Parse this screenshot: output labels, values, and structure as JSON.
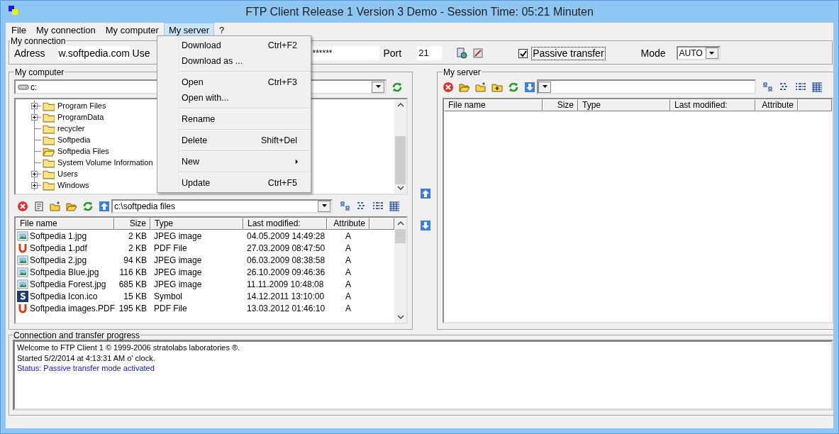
{
  "window": {
    "title": "FTP Client Release 1 Version 3 Demo - Session Time: 05:21 Minuten"
  },
  "menu_bar": [
    {
      "label": "File",
      "selected": false
    },
    {
      "label": "My connection",
      "selected": false
    },
    {
      "label": "My computer",
      "selected": false
    },
    {
      "label": "My server",
      "selected": true
    },
    {
      "label": "?",
      "selected": false
    }
  ],
  "dropdown_menu": {
    "items": [
      {
        "kind": "item",
        "label": "Download",
        "shortcut": "Ctrl+F2"
      },
      {
        "kind": "item",
        "label": "Download as ..."
      },
      {
        "kind": "separator"
      },
      {
        "kind": "item",
        "label": "Open",
        "shortcut": "Ctrl+F3"
      },
      {
        "kind": "item",
        "label": "Open with..."
      },
      {
        "kind": "separator"
      },
      {
        "kind": "item",
        "label": "Rename"
      },
      {
        "kind": "separator"
      },
      {
        "kind": "item",
        "label": "Delete",
        "shortcut": "Shift+Del"
      },
      {
        "kind": "separator"
      },
      {
        "kind": "submenu",
        "label": "New"
      },
      {
        "kind": "separator"
      },
      {
        "kind": "item",
        "label": "Update",
        "shortcut": "Ctrl+F5"
      }
    ]
  },
  "connection": {
    "group_label": "My connection",
    "address_label": "Adress",
    "address_value": "w.softpedia.com",
    "user_label": "Use",
    "password_value": "******",
    "port_label": "Port",
    "port_value": "21",
    "passive_transfer": {
      "label": "Passive transfer",
      "checked": true
    },
    "mode_label": "Mode",
    "mode_value": "AUTO"
  },
  "my_computer": {
    "title": "My computer",
    "drive": "c:",
    "tree": [
      {
        "label": "Program Files",
        "has_children": true,
        "open": false
      },
      {
        "label": "ProgramData",
        "has_children": true,
        "open": false
      },
      {
        "label": "recycler",
        "has_children": false,
        "open": false
      },
      {
        "label": "Softpedia",
        "has_children": false,
        "open": false
      },
      {
        "label": "Softpedia Files",
        "has_children": false,
        "open": true
      },
      {
        "label": "System Volume Information",
        "has_children": false,
        "open": false
      },
      {
        "label": "Users",
        "has_children": true,
        "open": false
      },
      {
        "label": "Windows",
        "has_children": true,
        "open": false
      }
    ],
    "path": "c:\\softpedia files",
    "columns": [
      "File name",
      "Size",
      "Type",
      "Last modified:",
      "Attribute"
    ],
    "rows": [
      {
        "kind": "image",
        "cells": [
          "Softpedia 1.jpg",
          "2 KB",
          "JPEG image",
          "04.05.2009 14:49:28",
          "A"
        ]
      },
      {
        "kind": "pdf",
        "cells": [
          "Softpedia 1.pdf",
          "2 KB",
          "PDF File",
          "27.03.2009 08:47:50",
          "A"
        ]
      },
      {
        "kind": "image",
        "cells": [
          "Softpedia 2.jpg",
          "94 KB",
          "JPEG image",
          "06.03.2009 08:38:58",
          "A"
        ]
      },
      {
        "kind": "image",
        "cells": [
          "Softpedia Blue.jpg",
          "116 KB",
          "JPEG image",
          "26.10.2009 09:46:36",
          "A"
        ]
      },
      {
        "kind": "image",
        "cells": [
          "Softpedia Forest.jpg",
          "685 KB",
          "JPEG image",
          "11.11.2009 10:48:08",
          "A"
        ]
      },
      {
        "kind": "symbol",
        "cells": [
          "Softpedia Icon.ico",
          "15 KB",
          "Symbol",
          "14.12.2011 13:10:00",
          "A"
        ]
      },
      {
        "kind": "pdf",
        "cells": [
          "Softpedia images.PDF",
          "195 KB",
          "PDF File",
          "13.03.2012 01:46:10",
          "A"
        ]
      }
    ]
  },
  "my_server": {
    "title": "My server",
    "columns": [
      "File name",
      "Size",
      "Type",
      "Last modified:",
      "Attribute"
    ]
  },
  "log": {
    "title": "Connection and transfer progress",
    "lines": [
      {
        "kind": "info",
        "text": "Welcome to FTP Client 1 © 1999-2006 stratolabs laboratories ®."
      },
      {
        "kind": "info",
        "text": "Started 5/2/2014 at 4:13:31 AM o' clock."
      },
      {
        "kind": "status",
        "text": "Status: Passive transfer mode activated"
      }
    ]
  }
}
